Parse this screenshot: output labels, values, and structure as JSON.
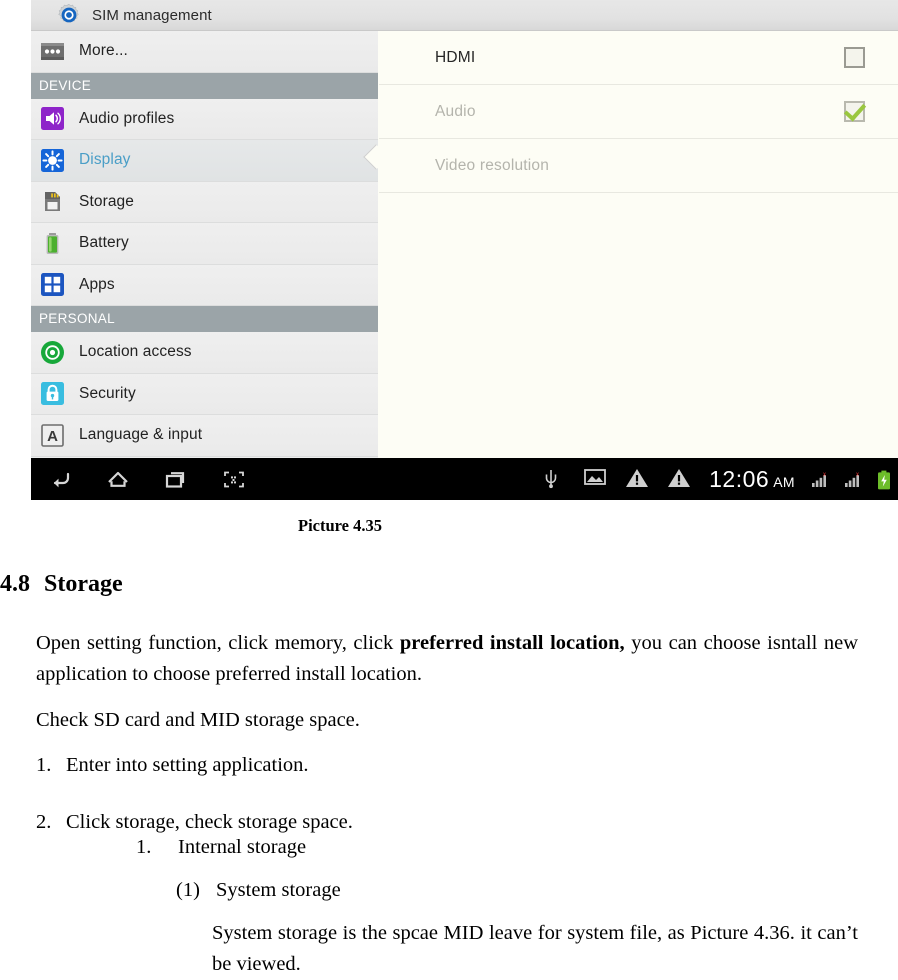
{
  "screenshot": {
    "header": {
      "title": "SIM management",
      "icon": "sim-gear-icon"
    },
    "sidebar": {
      "rows": [
        {
          "type": "item",
          "label": "More...",
          "icon": "more-dots-icon",
          "selected": false
        },
        {
          "type": "header",
          "label": "DEVICE"
        },
        {
          "type": "item",
          "label": "Audio profiles",
          "icon": "speaker-icon",
          "selected": false
        },
        {
          "type": "item",
          "label": "Display",
          "icon": "brightness-icon",
          "selected": true
        },
        {
          "type": "item",
          "label": "Storage",
          "icon": "sdcard-icon",
          "selected": false
        },
        {
          "type": "item",
          "label": "Battery",
          "icon": "battery-icon",
          "selected": false
        },
        {
          "type": "item",
          "label": "Apps",
          "icon": "apps-grid-icon",
          "selected": false
        },
        {
          "type": "header",
          "label": "PERSONAL"
        },
        {
          "type": "item",
          "label": "Location access",
          "icon": "location-icon",
          "selected": false
        },
        {
          "type": "item",
          "label": "Security",
          "icon": "lock-icon",
          "selected": false
        },
        {
          "type": "item",
          "label": "Language & input",
          "icon": "language-a-icon",
          "selected": false
        }
      ]
    },
    "detail": {
      "rows": [
        {
          "label": "HDMI",
          "control": "checkbox",
          "checked": false,
          "dimmed": false
        },
        {
          "label": "Audio",
          "control": "checkbox",
          "checked": true,
          "dimmed": true
        },
        {
          "label": "Video resolution",
          "control": "none",
          "checked": false,
          "dimmed": true
        }
      ]
    },
    "navbar": {
      "buttons": [
        "back-icon",
        "home-icon",
        "recents-icon",
        "screenshot-icon"
      ],
      "status_icons": [
        "usb-icon",
        "image-icon",
        "warning-icon",
        "warning-icon"
      ],
      "clock": "12:06",
      "ampm": "AM",
      "signal_icons": [
        "signal-bars-icon",
        "signal-bars-icon"
      ],
      "battery_icon": "battery-charging-icon"
    },
    "colors": {
      "selected_label": "#4a9ec7",
      "section_header_bg": "#9ba4a8",
      "check_green": "#9ac73f",
      "panel_bg": "#fdfdf5"
    }
  },
  "document": {
    "caption": "Picture 4.35",
    "heading": {
      "number": "4.8",
      "title": "Storage"
    },
    "paragraph1_a": "Open setting function, click memory, click ",
    "paragraph1_bold": "preferred install location,",
    "paragraph1_b": " you can choose isntall new application to choose preferred install location.",
    "paragraph2": "Check SD card and MID storage space.",
    "list": [
      {
        "marker": "1.",
        "text": "Enter into setting application."
      },
      {
        "marker": "2.",
        "text": "Click storage, check storage space."
      },
      {
        "marker": "1.",
        "text": "Internal storage"
      },
      {
        "marker": "(1)",
        "text": "System storage"
      }
    ],
    "paragraph3": "System storage is the spcae MID leave for system file, as Picture 4.36. it can’t be viewed."
  }
}
